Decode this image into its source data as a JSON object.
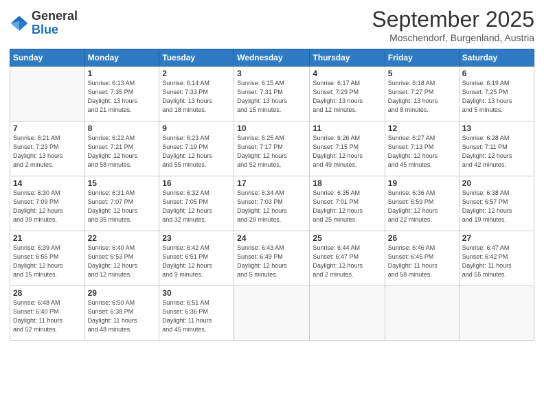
{
  "header": {
    "logo_general": "General",
    "logo_blue": "Blue",
    "month_title": "September 2025",
    "location": "Moschendorf, Burgenland, Austria"
  },
  "days_of_week": [
    "Sunday",
    "Monday",
    "Tuesday",
    "Wednesday",
    "Thursday",
    "Friday",
    "Saturday"
  ],
  "weeks": [
    [
      {
        "day": "",
        "info": ""
      },
      {
        "day": "1",
        "info": "Sunrise: 6:13 AM\nSunset: 7:35 PM\nDaylight: 13 hours\nand 21 minutes."
      },
      {
        "day": "2",
        "info": "Sunrise: 6:14 AM\nSunset: 7:33 PM\nDaylight: 13 hours\nand 18 minutes."
      },
      {
        "day": "3",
        "info": "Sunrise: 6:15 AM\nSunset: 7:31 PM\nDaylight: 13 hours\nand 15 minutes."
      },
      {
        "day": "4",
        "info": "Sunrise: 6:17 AM\nSunset: 7:29 PM\nDaylight: 13 hours\nand 12 minutes."
      },
      {
        "day": "5",
        "info": "Sunrise: 6:18 AM\nSunset: 7:27 PM\nDaylight: 13 hours\nand 8 minutes."
      },
      {
        "day": "6",
        "info": "Sunrise: 6:19 AM\nSunset: 7:25 PM\nDaylight: 13 hours\nand 5 minutes."
      }
    ],
    [
      {
        "day": "7",
        "info": "Sunrise: 6:21 AM\nSunset: 7:23 PM\nDaylight: 13 hours\nand 2 minutes."
      },
      {
        "day": "8",
        "info": "Sunrise: 6:22 AM\nSunset: 7:21 PM\nDaylight: 12 hours\nand 58 minutes."
      },
      {
        "day": "9",
        "info": "Sunrise: 6:23 AM\nSunset: 7:19 PM\nDaylight: 12 hours\nand 55 minutes."
      },
      {
        "day": "10",
        "info": "Sunrise: 6:25 AM\nSunset: 7:17 PM\nDaylight: 12 hours\nand 52 minutes."
      },
      {
        "day": "11",
        "info": "Sunrise: 6:26 AM\nSunset: 7:15 PM\nDaylight: 12 hours\nand 49 minutes."
      },
      {
        "day": "12",
        "info": "Sunrise: 6:27 AM\nSunset: 7:13 PM\nDaylight: 12 hours\nand 45 minutes."
      },
      {
        "day": "13",
        "info": "Sunrise: 6:28 AM\nSunset: 7:11 PM\nDaylight: 12 hours\nand 42 minutes."
      }
    ],
    [
      {
        "day": "14",
        "info": "Sunrise: 6:30 AM\nSunset: 7:09 PM\nDaylight: 12 hours\nand 39 minutes."
      },
      {
        "day": "15",
        "info": "Sunrise: 6:31 AM\nSunset: 7:07 PM\nDaylight: 12 hours\nand 35 minutes."
      },
      {
        "day": "16",
        "info": "Sunrise: 6:32 AM\nSunset: 7:05 PM\nDaylight: 12 hours\nand 32 minutes."
      },
      {
        "day": "17",
        "info": "Sunrise: 6:34 AM\nSunset: 7:03 PM\nDaylight: 12 hours\nand 29 minutes."
      },
      {
        "day": "18",
        "info": "Sunrise: 6:35 AM\nSunset: 7:01 PM\nDaylight: 12 hours\nand 25 minutes."
      },
      {
        "day": "19",
        "info": "Sunrise: 6:36 AM\nSunset: 6:59 PM\nDaylight: 12 hours\nand 22 minutes."
      },
      {
        "day": "20",
        "info": "Sunrise: 6:38 AM\nSunset: 6:57 PM\nDaylight: 12 hours\nand 19 minutes."
      }
    ],
    [
      {
        "day": "21",
        "info": "Sunrise: 6:39 AM\nSunset: 6:55 PM\nDaylight: 12 hours\nand 15 minutes."
      },
      {
        "day": "22",
        "info": "Sunrise: 6:40 AM\nSunset: 6:53 PM\nDaylight: 12 hours\nand 12 minutes."
      },
      {
        "day": "23",
        "info": "Sunrise: 6:42 AM\nSunset: 6:51 PM\nDaylight: 12 hours\nand 9 minutes."
      },
      {
        "day": "24",
        "info": "Sunrise: 6:43 AM\nSunset: 6:49 PM\nDaylight: 12 hours\nand 5 minutes."
      },
      {
        "day": "25",
        "info": "Sunrise: 6:44 AM\nSunset: 6:47 PM\nDaylight: 12 hours\nand 2 minutes."
      },
      {
        "day": "26",
        "info": "Sunrise: 6:46 AM\nSunset: 6:45 PM\nDaylight: 11 hours\nand 58 minutes."
      },
      {
        "day": "27",
        "info": "Sunrise: 6:47 AM\nSunset: 6:42 PM\nDaylight: 11 hours\nand 55 minutes."
      }
    ],
    [
      {
        "day": "28",
        "info": "Sunrise: 6:48 AM\nSunset: 6:40 PM\nDaylight: 11 hours\nand 52 minutes."
      },
      {
        "day": "29",
        "info": "Sunrise: 6:50 AM\nSunset: 6:38 PM\nDaylight: 11 hours\nand 48 minutes."
      },
      {
        "day": "30",
        "info": "Sunrise: 6:51 AM\nSunset: 6:36 PM\nDaylight: 11 hours\nand 45 minutes."
      },
      {
        "day": "",
        "info": ""
      },
      {
        "day": "",
        "info": ""
      },
      {
        "day": "",
        "info": ""
      },
      {
        "day": "",
        "info": ""
      }
    ]
  ]
}
